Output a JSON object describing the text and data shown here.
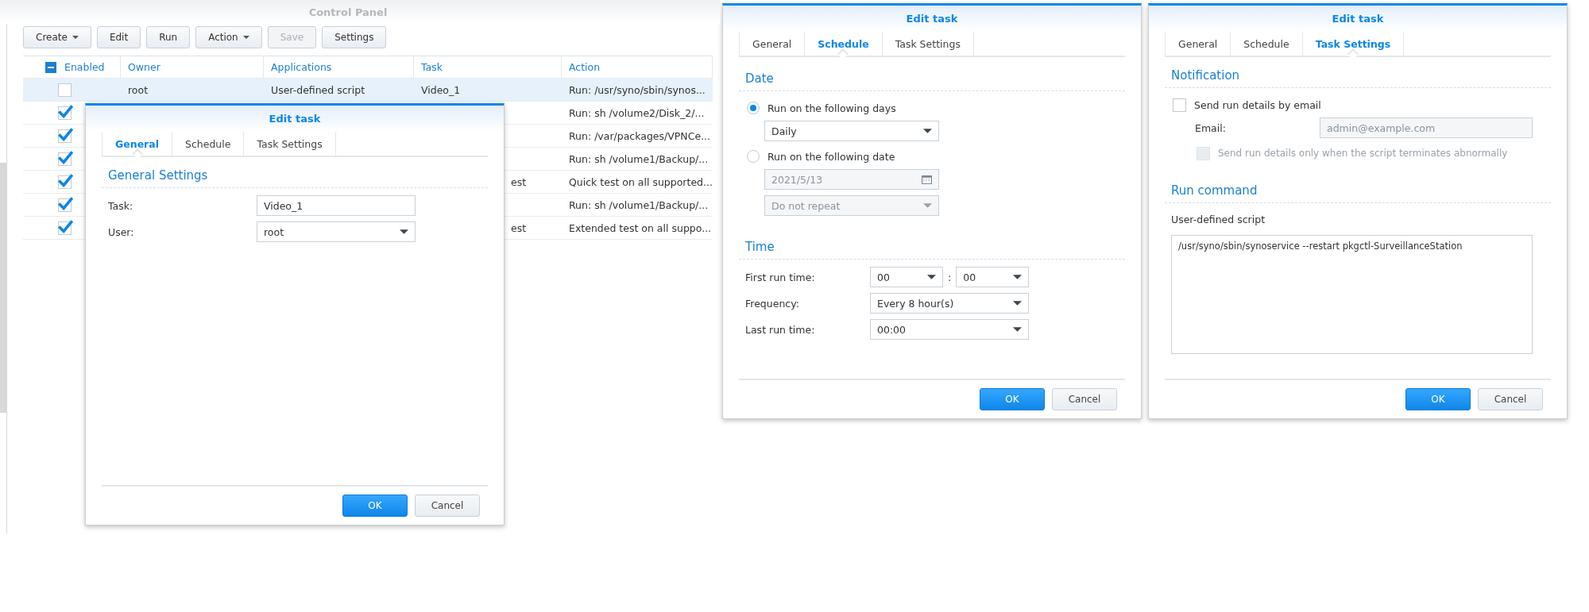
{
  "control_panel": {
    "title": "Control Panel",
    "toolbar": [
      {
        "label": "Create",
        "dropdown": true,
        "disabled": false
      },
      {
        "label": "Edit",
        "dropdown": false,
        "disabled": false
      },
      {
        "label": "Run",
        "dropdown": false,
        "disabled": false
      },
      {
        "label": "Action",
        "dropdown": true,
        "disabled": false
      },
      {
        "label": "Save",
        "dropdown": false,
        "disabled": true
      },
      {
        "label": "Settings",
        "dropdown": false,
        "disabled": false
      }
    ],
    "table": {
      "header_checkbox": {
        "indeterminate": true
      },
      "columns": [
        "Enabled",
        "Owner",
        "Applications",
        "Task",
        "Action"
      ],
      "rows": [
        {
          "enabled": false,
          "selected": true,
          "owner": "root",
          "application": "User-defined script",
          "task": "Video_1",
          "action": "Run: /usr/syno/sbin/synos..."
        },
        {
          "enabled": true,
          "selected": false,
          "action": "Run: sh /volume2/Disk_2/..."
        },
        {
          "enabled": true,
          "selected": false,
          "action": "Run: /var/packages/VPNCe..."
        },
        {
          "enabled": true,
          "selected": false,
          "action": "Run: sh /volume1/Backup/..."
        },
        {
          "enabled": true,
          "selected": false,
          "task": "est",
          "action": "Quick test on all supported..."
        },
        {
          "enabled": true,
          "selected": false,
          "action": "Run: sh /volume1/Backup/..."
        },
        {
          "enabled": true,
          "selected": false,
          "task": "est",
          "action": "Extended test on all suppo..."
        }
      ]
    }
  },
  "dialogs": [
    {
      "title": "Edit task",
      "tabs": [
        {
          "label": "General",
          "selected": true
        },
        {
          "label": "Schedule",
          "selected": false
        },
        {
          "label": "Task Settings",
          "selected": false
        }
      ],
      "items": [
        {
          "kind": "heading",
          "text": "General Settings"
        },
        {
          "kind": "field",
          "label": "Task:",
          "value": "Video_1"
        },
        {
          "kind": "select",
          "label": "User:",
          "value": "root"
        }
      ],
      "buttons": [
        {
          "label": "OK",
          "primary": true
        },
        {
          "label": "Cancel",
          "primary": false
        }
      ]
    },
    {
      "title": "Edit task",
      "tabs": [
        {
          "label": "General",
          "selected": false
        },
        {
          "label": "Schedule",
          "selected": true
        },
        {
          "label": "Task Settings",
          "selected": false
        }
      ],
      "items": [
        {
          "kind": "heading",
          "text": "Date"
        },
        {
          "kind": "radio",
          "label": "Run on the following days",
          "selected": true
        },
        {
          "kind": "select",
          "value": "Daily",
          "indent": true,
          "disabled": false
        },
        {
          "kind": "radio",
          "label": "Run on the following date",
          "selected": false
        },
        {
          "kind": "date",
          "value": "2021/5/13",
          "indent": true,
          "disabled": true
        },
        {
          "kind": "select",
          "value": "Do not repeat",
          "indent": true,
          "disabled": true
        },
        {
          "kind": "heading",
          "text": "Time"
        },
        {
          "kind": "time",
          "label": "First run time:",
          "hour": "00",
          "separator": ":",
          "minute": "00"
        },
        {
          "kind": "select",
          "label": "Frequency:",
          "value": "Every 8 hour(s)"
        },
        {
          "kind": "select",
          "label": "Last run time:",
          "value": "00:00"
        }
      ],
      "buttons": [
        {
          "label": "OK",
          "primary": true
        },
        {
          "label": "Cancel",
          "primary": false
        }
      ]
    },
    {
      "title": "Edit task",
      "tabs": [
        {
          "label": "General",
          "selected": false
        },
        {
          "label": "Schedule",
          "selected": false
        },
        {
          "label": "Task Settings",
          "selected": true
        }
      ],
      "items": [
        {
          "kind": "heading",
          "text": "Notification"
        },
        {
          "kind": "checkbox",
          "label": "Send run details by email",
          "checked": false,
          "disabled": false,
          "children": [
            {
              "kind": "field",
              "label": "Email:",
              "value": "admin@example.com",
              "disabled": true
            },
            {
              "kind": "checkbox",
              "label": "Send run details only when the script terminates abnormally",
              "checked": false,
              "disabled": true
            }
          ]
        },
        {
          "kind": "heading",
          "text": "Run command"
        },
        {
          "kind": "text",
          "text": "User-defined script"
        },
        {
          "kind": "textarea",
          "value": "/usr/syno/sbin/synoservice --restart pkgctl-SurveillanceStation"
        }
      ],
      "buttons": [
        {
          "label": "OK",
          "primary": true
        },
        {
          "label": "Cancel",
          "primary": false
        }
      ]
    }
  ]
}
